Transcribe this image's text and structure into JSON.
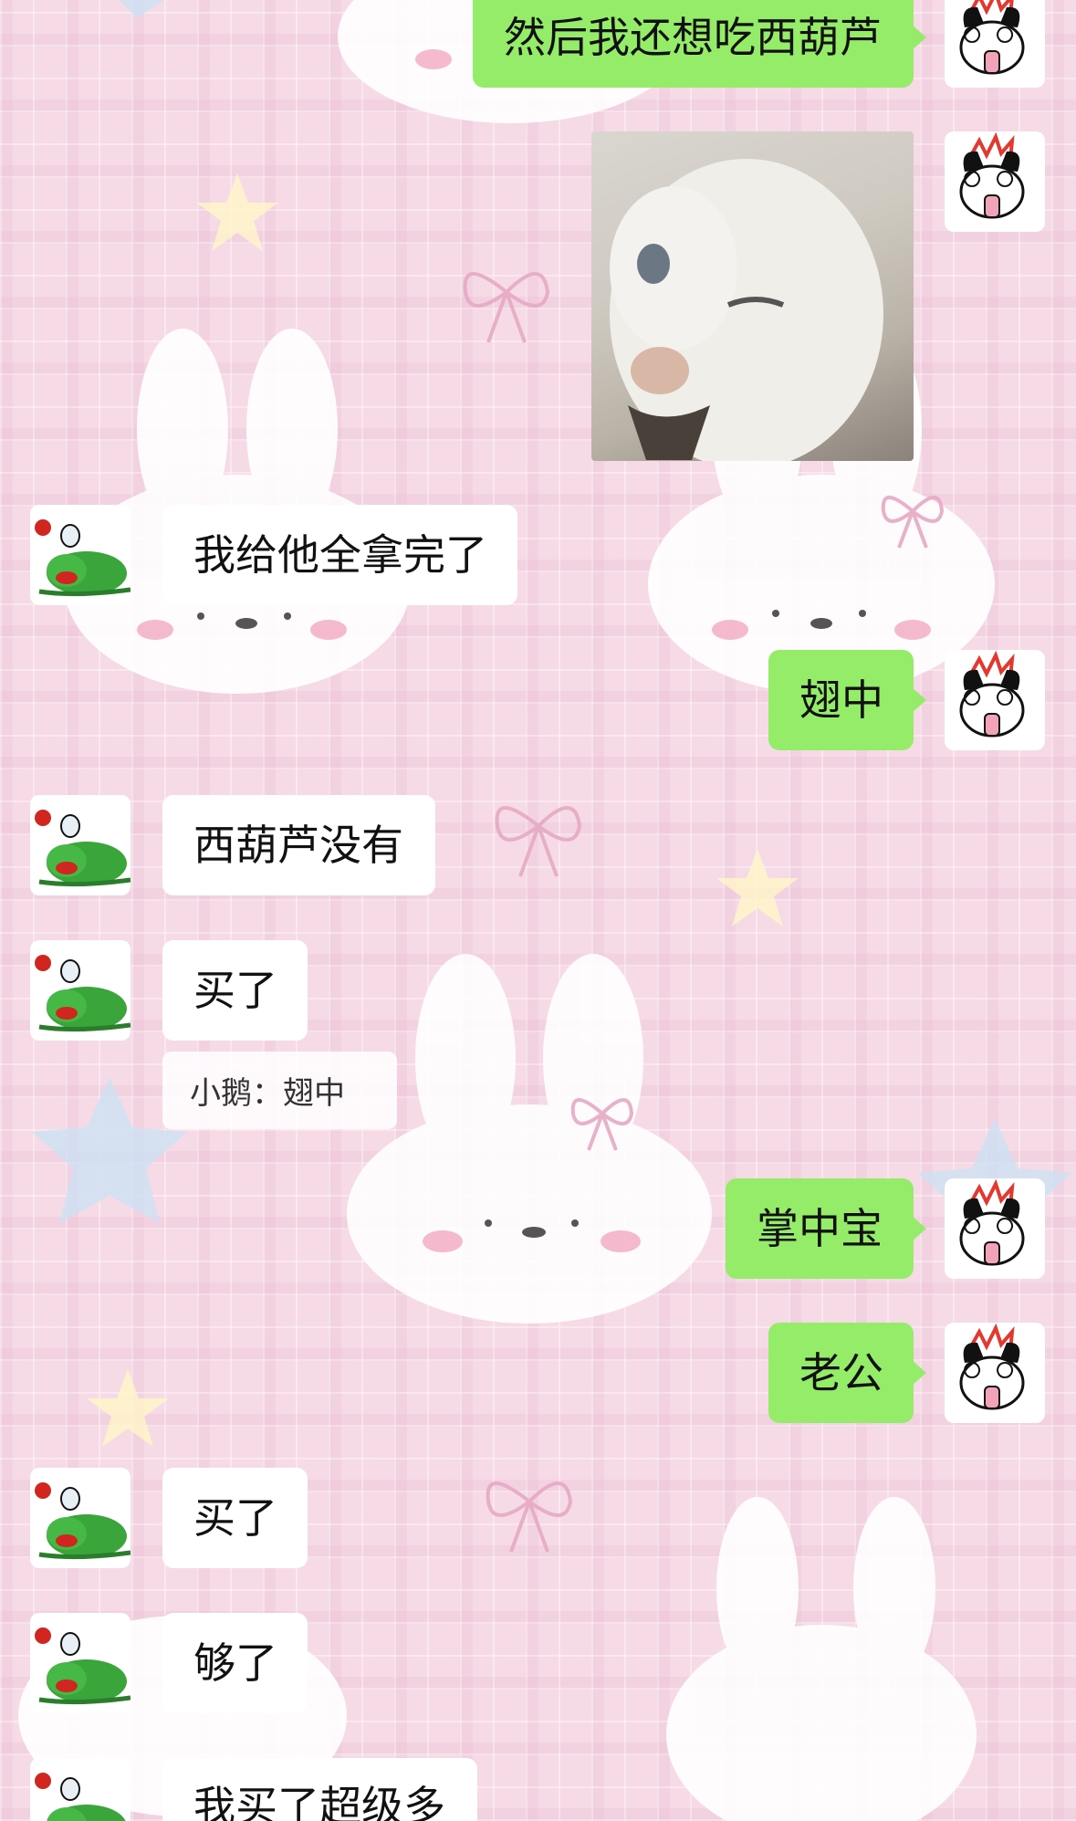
{
  "colors": {
    "background": "#f6dbe6",
    "sent_bubble": "#95ec69",
    "received_bubble": "#ffffff"
  },
  "messages": [
    {
      "side": "right",
      "type": "text",
      "text": "然后我还想吃西葫芦",
      "avatar": "cartoon-rabbit-avatar"
    },
    {
      "side": "right",
      "type": "image",
      "text": "",
      "avatar": "cartoon-rabbit-avatar",
      "image": "winking-white-cat-sticker"
    },
    {
      "side": "left",
      "type": "text",
      "text": "我给他全拿完了",
      "avatar": "green-frog-avatar"
    },
    {
      "side": "right",
      "type": "text",
      "text": "翅中",
      "avatar": "cartoon-rabbit-avatar"
    },
    {
      "side": "left",
      "type": "text",
      "text": "西葫芦没有",
      "avatar": "green-frog-avatar"
    },
    {
      "side": "left",
      "type": "text",
      "text": "买了",
      "avatar": "green-frog-avatar",
      "quote": "小鹅：翅中"
    },
    {
      "side": "right",
      "type": "text",
      "text": "掌中宝",
      "avatar": "cartoon-rabbit-avatar"
    },
    {
      "side": "right",
      "type": "text",
      "text": "老公",
      "avatar": "cartoon-rabbit-avatar"
    },
    {
      "side": "left",
      "type": "text",
      "text": "买了",
      "avatar": "green-frog-avatar"
    },
    {
      "side": "left",
      "type": "text",
      "text": "够了",
      "avatar": "green-frog-avatar"
    },
    {
      "side": "left",
      "type": "text",
      "text": "我买了超级多",
      "avatar": "green-frog-avatar"
    }
  ]
}
